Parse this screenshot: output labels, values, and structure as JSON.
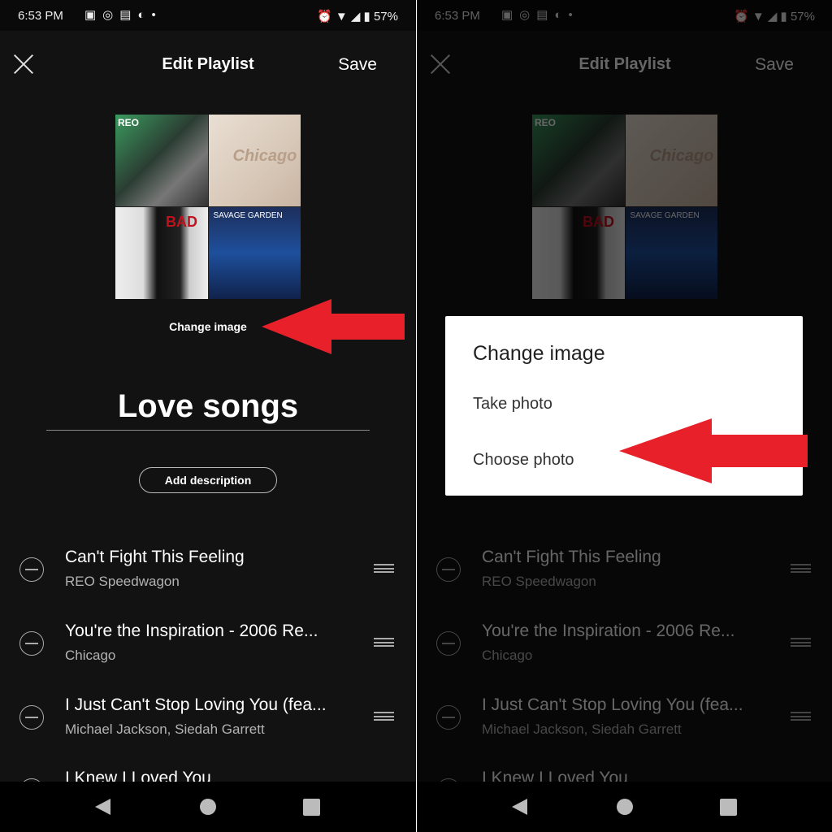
{
  "status": {
    "time": "6:53 PM",
    "icons": [
      "image-icon",
      "viber-icon",
      "shop-icon",
      "nav-icon",
      "dot"
    ],
    "battery": "57%"
  },
  "header": {
    "title": "Edit Playlist",
    "save": "Save"
  },
  "cover": {
    "logos": [
      "REO",
      "Chicago",
      "BAD",
      "SAVAGE GARDEN"
    ]
  },
  "change_image": "Change image",
  "playlist_name": "Love songs",
  "add_description": "Add description",
  "tracks": [
    {
      "title": "Can't Fight This Feeling",
      "artist": "REO Speedwagon"
    },
    {
      "title": "You're the Inspiration - 2006 Re...",
      "artist": "Chicago"
    },
    {
      "title": "I Just Can't Stop Loving You (fea...",
      "artist": "Michael Jackson, Siedah Garrett"
    },
    {
      "title": "I Knew I Loved You",
      "artist": ""
    }
  ],
  "dialog": {
    "title": "Change image",
    "options": [
      "Take photo",
      "Choose photo"
    ]
  },
  "colors": {
    "arrow": "#e8202a",
    "background": "#121212"
  }
}
